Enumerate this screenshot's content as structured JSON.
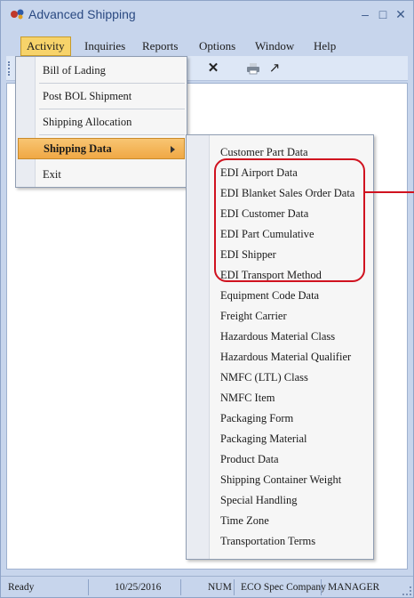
{
  "window": {
    "title": "Advanced Shipping",
    "minimize_glyph": "–",
    "maximize_glyph": "□",
    "close_glyph": "✕"
  },
  "menubar": [
    {
      "id": "activity",
      "label": "Activity"
    },
    {
      "id": "inquiries",
      "label": "Inquiries"
    },
    {
      "id": "reports",
      "label": "Reports"
    },
    {
      "id": "options",
      "label": "Options"
    },
    {
      "id": "window",
      "label": "Window"
    },
    {
      "id": "help",
      "label": "Help"
    }
  ],
  "toolbar": {
    "icons": [
      "delete-icon",
      "print-icon",
      "pin-icon"
    ]
  },
  "activity_menu": {
    "items": [
      {
        "id": "bill-of-lading",
        "label": "Bill of Lading"
      },
      {
        "id": "post-bol-shipment",
        "label": "Post BOL Shipment"
      },
      {
        "id": "shipping-allocation",
        "label": "Shipping Allocation"
      },
      {
        "id": "shipping-data",
        "label": "Shipping Data"
      },
      {
        "id": "exit",
        "label": "Exit"
      }
    ]
  },
  "shipping_data_submenu": {
    "items": [
      "Customer Part Data",
      "EDI Airport Data",
      "EDI Blanket Sales Order Data",
      "EDI Customer Data",
      "EDI Part Cumulative",
      "EDI Shipper",
      "EDI Transport Method",
      "Equipment Code Data",
      "Freight Carrier",
      "Hazardous Material Class",
      "Hazardous Material Qualifier",
      "NMFC (LTL) Class",
      "NMFC Item",
      "Packaging Form",
      "Packaging Material",
      "Product Data",
      "Shipping Container Weight",
      "Special Handling",
      "Time Zone",
      "Transportation Terms"
    ]
  },
  "statusbar": {
    "status": "Ready",
    "date": "10/25/2016",
    "num": "NUM",
    "company": "ECO Spec Company",
    "user": "MANAGER"
  },
  "colors": {
    "accent": "#f0a845",
    "callout": "#d0121f",
    "frame": "#c7d5ec"
  }
}
